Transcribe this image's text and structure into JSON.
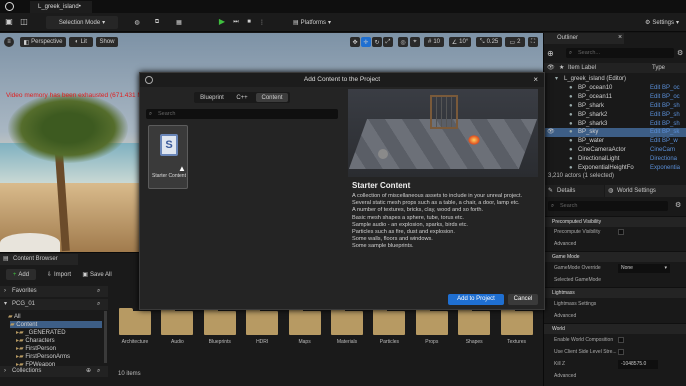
{
  "title_bar": {
    "level_tab": "L_greek_island•"
  },
  "toolbar": {
    "selection_mode": "Selection Mode",
    "platforms": "Platforms",
    "settings": "Settings"
  },
  "viewport": {
    "perspective": "Perspective",
    "lit": "Lit",
    "show": "Show",
    "warning": "Video memory has been exhausted (671.431 MB",
    "grid_snap": "10",
    "rotate_snap": "10°",
    "scale_snap": "0.25",
    "camera_speed": "2"
  },
  "outliner": {
    "tab": "Outliner",
    "search_placeholder": "Search...",
    "col_item_label": "Item Label",
    "col_type": "Type",
    "rows": [
      {
        "label": "L_greek_island (Editor)",
        "type": ""
      },
      {
        "label": "BP_ocean10",
        "type": "Edit BP_oc"
      },
      {
        "label": "BP_ocean11",
        "type": "Edit BP_oc"
      },
      {
        "label": "BP_shark",
        "type": "Edit BP_sh"
      },
      {
        "label": "BP_shark2",
        "type": "Edit BP_sh"
      },
      {
        "label": "BP_shark3",
        "type": "Edit BP_sh"
      },
      {
        "label": "BP_sky",
        "type": "Edit BP_sk"
      },
      {
        "label": "BP_water",
        "type": "Edit BP_w"
      },
      {
        "label": "CineCameraActor",
        "type": "CineCam"
      },
      {
        "label": "DirectionalLight",
        "type": "Directiona"
      },
      {
        "label": "ExponentialHeightFo",
        "type": "Exponentia"
      }
    ],
    "footer": "3,210 actors (1 selected)"
  },
  "details": {
    "tab_details": "Details",
    "tab_world": "World Settings",
    "search_placeholder": "Search",
    "sections": {
      "precomputed_visibility": "Precomputed Visibility",
      "precompute_visibility": "Precompute Visibility",
      "advanced1": "Advanced",
      "game_mode": "Game Mode",
      "gamemode_override": "GameMode Override",
      "gamemode_value": "None",
      "selected_gamemode": "Selected GameMode",
      "lightmass": "Lightmass",
      "lightmass_settings": "Lightmass Settings",
      "advanced2": "Advanced",
      "world": "World",
      "enable_world_composition": "Enable World Composition",
      "use_client_side": "Use Client Side Level Stre...",
      "kill_z": "Kill Z",
      "kill_z_value": "-1048575.0",
      "advanced3": "Advanced"
    }
  },
  "content_browser": {
    "tab": "Content Browser",
    "add": "Add",
    "import": "Import",
    "save_all": "Save All",
    "favorites": "Favorites",
    "project": "PCG_01",
    "all": "All",
    "content": "Content",
    "folders_tree": [
      "_GENERATED",
      "Characters",
      "FirstPerson",
      "FirstPersonArms",
      "FPWeapon"
    ],
    "collections": "Collections",
    "folders": [
      "Architecture",
      "Audio",
      "Blueprints",
      "HDRI",
      "Maps",
      "Materials",
      "Particles",
      "Props",
      "Shapes",
      "Textures"
    ],
    "item_count": "10 items"
  },
  "dialog": {
    "title": "Add Content to the Project",
    "tabs": [
      "Blueprint",
      "C++",
      "Content"
    ],
    "search_placeholder": "Search",
    "tile_label": "Starter Content",
    "preview_title": "Starter Content",
    "description": [
      "A collection of miscellaneous assets to include in your unreal project.",
      "Several static mesh props such as a table, a chair, a door, lamp etc.",
      "A number of textures, bricks, clay, wood and so forth.",
      "Basic mesh shapes a sphere, tube, torus etc.",
      "Sample audio - an explosion, sparks, birds etc.",
      "Particles such as fire, dust and explosion.",
      "Some walls, floors and windows.",
      "Some sample blueprints."
    ],
    "add_button": "Add to Project",
    "cancel_button": "Cancel"
  },
  "colors": {
    "accent_blue": "#1f6fd1",
    "selected_row": "#3d5e86",
    "play_green": "#3fbf3f",
    "warning_red": "#e02020",
    "folder": "#b79a63"
  }
}
